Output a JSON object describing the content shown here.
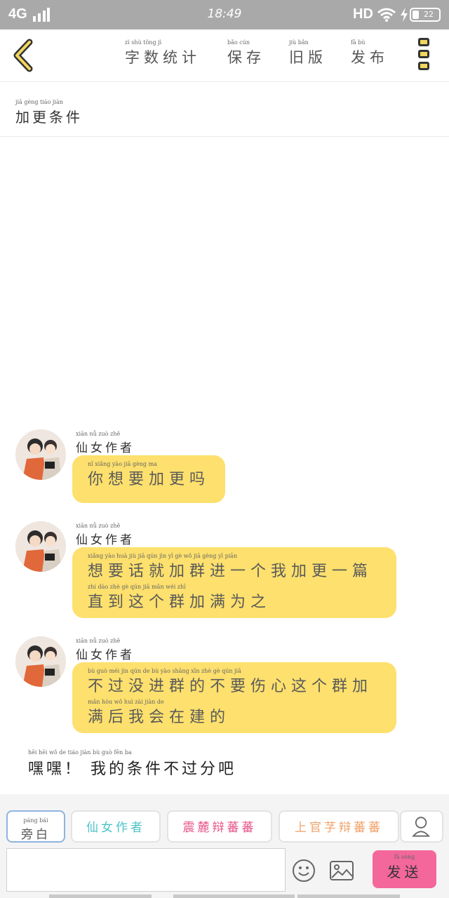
{
  "status_bar": {
    "network": "4G",
    "time": "18:49",
    "hd": "HD",
    "battery": "22"
  },
  "header": {
    "menu": [
      {
        "label": "字数统计",
        "pinyin": "zì shù tǒng jì"
      },
      {
        "label": "保存",
        "pinyin": "bǎo cún"
      },
      {
        "label": "旧版",
        "pinyin": "jiù bǎn"
      },
      {
        "label": "发布",
        "pinyin": "fā bù"
      }
    ]
  },
  "title": {
    "text": "加更条件",
    "pinyin": "jiā gèng tiáo jiàn"
  },
  "messages": [
    {
      "sender": "仙女作者",
      "sender_pinyin": "xiān nǚ zuò zhě",
      "lines": [
        {
          "text": "你想要加更吗",
          "pinyin": "nǐ xiǎng yào jiā gèng ma"
        }
      ]
    },
    {
      "sender": "仙女作者",
      "sender_pinyin": "xiān nǚ zuò zhě",
      "lines": [
        {
          "text": "想要话就加群进一个我加更一篇",
          "pinyin": "xiǎng yào huà jiù jiā qún jìn yī gè wǒ jiā gèng yī piān"
        },
        {
          "text": "直到这个群加满为之",
          "pinyin": "zhí dào zhè gè qún jiā mǎn wéi zhī"
        }
      ]
    },
    {
      "sender": "仙女作者",
      "sender_pinyin": "xiān nǚ zuò zhě",
      "lines": [
        {
          "text": "不过没进群的不要伤心这个群加",
          "pinyin": "bù guò méi jìn qún de bù yào shāng xīn zhè gè qún jiā"
        },
        {
          "text": "满后我会在建的",
          "pinyin": "mǎn hòu wǒ huì zài jiàn de"
        }
      ]
    }
  ],
  "narration": {
    "text": "嘿嘿！ 我的条件不过分吧",
    "pinyin": "hēi hēi    wǒ de tiáo jiàn bù guò fēn ba"
  },
  "roles": [
    {
      "label": "旁白",
      "pinyin": "páng bái",
      "color": "#555555"
    },
    {
      "label": "仙女作者",
      "pinyin": "",
      "color": "#4cc3c9"
    },
    {
      "label": "震麓辩蕃蕃",
      "pinyin": "",
      "color": "#e7568a"
    },
    {
      "label": "上官芓辩蕃蕃",
      "pinyin": "",
      "color": "#f0a36a"
    }
  ],
  "input": {
    "value": ""
  },
  "send": {
    "label": "发送",
    "pinyin": "fā sòng"
  },
  "colors": {
    "accent": "#fde06d",
    "send": "#f4679a"
  }
}
